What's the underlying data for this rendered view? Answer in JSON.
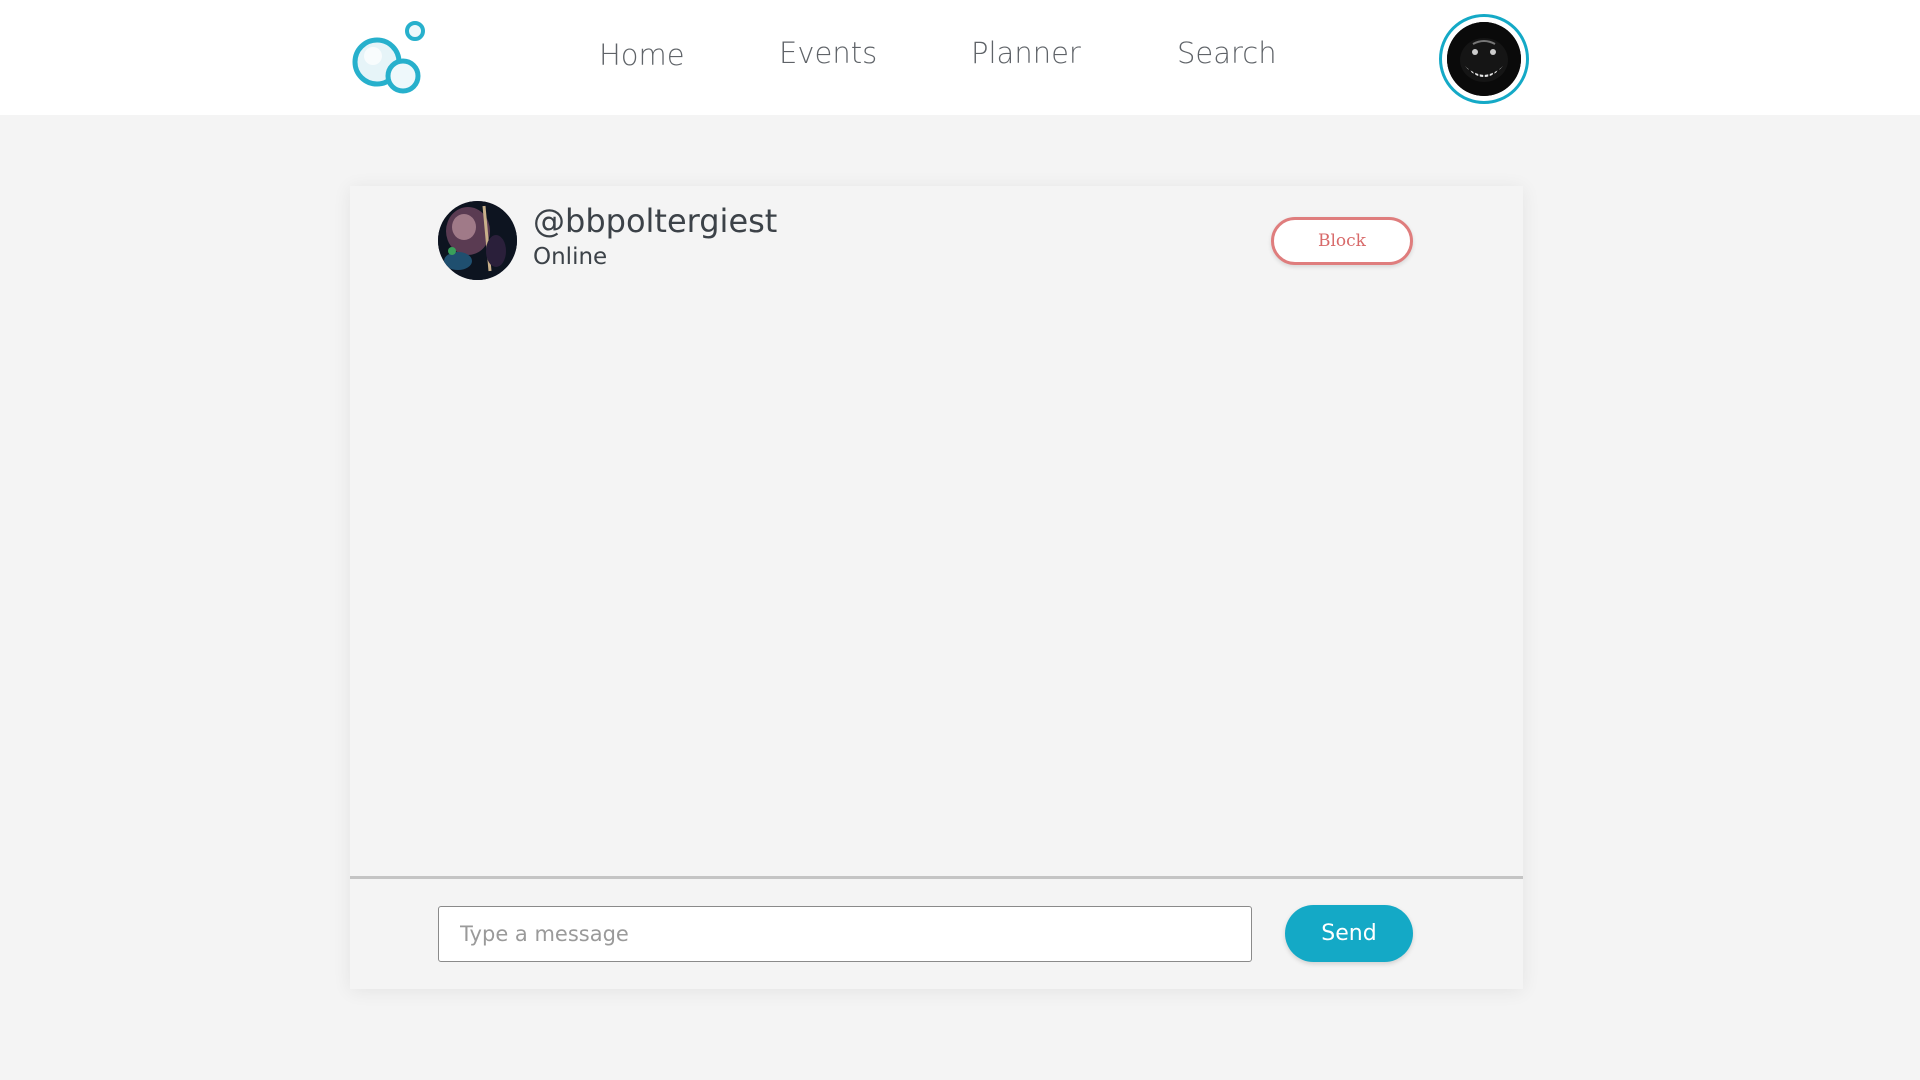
{
  "app": {
    "logo_icon": "bubbles-logo-icon",
    "accent_color": "#14a9c6"
  },
  "nav": {
    "items": [
      {
        "label": "Home"
      },
      {
        "label": "Events"
      },
      {
        "label": "Planner"
      },
      {
        "label": "Search"
      }
    ],
    "profile_avatar_icon": "user-avatar-icon"
  },
  "chat": {
    "contact": {
      "username": "@bbpoltergiest",
      "status": "Online",
      "avatar_icon": "contact-avatar-icon"
    },
    "block_label": "Block",
    "block_color": "#df7d7d",
    "messages": [],
    "input": {
      "value": "",
      "placeholder": "Type a message"
    },
    "send_label": "Send"
  }
}
